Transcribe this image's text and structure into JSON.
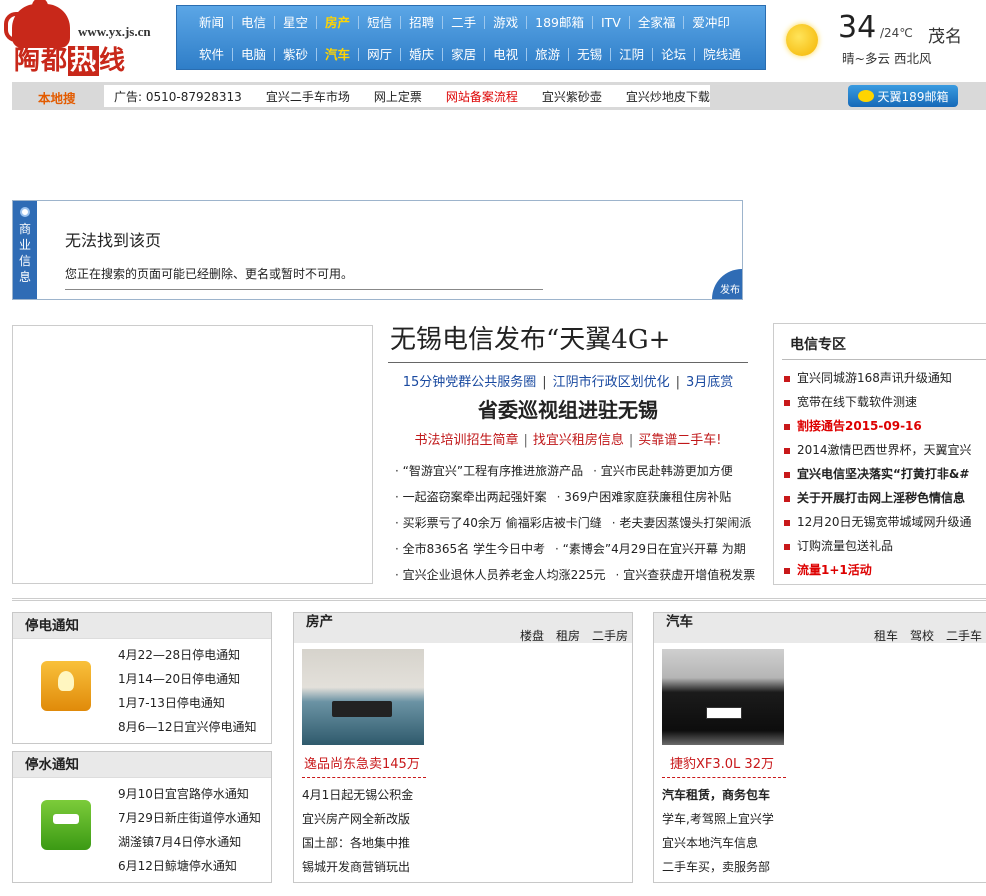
{
  "logo": {
    "url": "www.yx.js.cn",
    "name_1": "陶都",
    "name_2": "热",
    "name_3": "线"
  },
  "topnav": {
    "row1": [
      {
        "label": "新闻"
      },
      {
        "label": "电信"
      },
      {
        "label": "星空"
      },
      {
        "label": "房产",
        "highlight": true
      },
      {
        "label": "短信"
      },
      {
        "label": "招聘"
      },
      {
        "label": "二手"
      },
      {
        "label": "游戏"
      },
      {
        "label": "189邮箱"
      },
      {
        "label": "ITV"
      },
      {
        "label": "全家福"
      },
      {
        "label": "爱冲印"
      }
    ],
    "row2": [
      {
        "label": "软件"
      },
      {
        "label": "电脑"
      },
      {
        "label": "紫砂"
      },
      {
        "label": "汽车",
        "highlight": true
      },
      {
        "label": "网厅"
      },
      {
        "label": "婚庆"
      },
      {
        "label": "家居"
      },
      {
        "label": "电视"
      },
      {
        "label": "旅游"
      },
      {
        "label": "无锡"
      },
      {
        "label": "江阴"
      },
      {
        "label": "论坛"
      },
      {
        "label": "院线通"
      }
    ]
  },
  "weather": {
    "temp_high": "34",
    "temp_low": "/24℃",
    "city": "茂名",
    "desc": "晴~多云  西北风",
    "icon": "sun-icon"
  },
  "bar2": {
    "local_label": "本地搜",
    "ads": [
      {
        "text": "广告: 0510-87928313"
      },
      {
        "text": "宜兴二手车市场"
      },
      {
        "text": "网上定票"
      },
      {
        "text": "网站备案流程",
        "red": true
      },
      {
        "text": "宜兴紫砂壶"
      },
      {
        "text": "宜兴炒地皮下载"
      }
    ],
    "tianyi_label": "天翼189邮箱"
  },
  "error": {
    "tab_label": "商业信息",
    "title": "无法找到该页",
    "message": "您正在搜索的页面可能已经删除、更名或暂时不可用。",
    "publish_label": "发布"
  },
  "headline": {
    "title": "无锡电信发布“天翼4G+",
    "links1": [
      "15分钟党群公共服务圈",
      "江阴市行政区划优化",
      "3月底赏"
    ],
    "title2": "省委巡视组进驻无锡",
    "links2": [
      "书法培训招生简章",
      "找宜兴租房信息",
      "买靠谱二手车!"
    ],
    "news": [
      [
        "“智游宜兴”工程有序推进旅游产品",
        "宜兴市民赴韩游更加方便"
      ],
      [
        "一起盗窃案牵出两起强奸案",
        "369户困难家庭获廉租住房补贴"
      ],
      [
        "买彩票亏了40余万 偷福彩店被卡门缝",
        "老夫妻因蒸馒头打架闹派"
      ],
      [
        "全市8365名 学生今日中考",
        "“素博会”4月29日在宜兴开幕 为期"
      ],
      [
        "宜兴企业退休人员养老金人均涨225元",
        "宜兴查获虚开增值税发票"
      ]
    ]
  },
  "dianxin": {
    "title": "电信专区",
    "items": [
      {
        "text": "宜兴同城游168声讯升级通知",
        "style": ""
      },
      {
        "text": "宽带在线下载软件测速",
        "style": ""
      },
      {
        "text": "割接通告2015-09-16",
        "style": "red"
      },
      {
        "text": "2014激情巴西世界杯，天翼宜兴",
        "style": ""
      },
      {
        "text": "宜兴电信坚决落实“打黄打非&#",
        "style": "b"
      },
      {
        "text": "关于开展打击网上淫秽色情信息",
        "style": "b"
      },
      {
        "text": "12月20日无锡宽带城域网升级通",
        "style": ""
      },
      {
        "text": "订购流量包送礼品",
        "style": ""
      },
      {
        "text": "流量1+1活动",
        "style": "red"
      }
    ]
  },
  "power": {
    "title": "停电通知",
    "items": [
      "4月22—28日停电通知",
      "1月14—20日停电通知",
      "1月7-13日停电通知",
      "8月6—12日宜兴停电通知"
    ]
  },
  "water": {
    "title": "停水通知",
    "items": [
      "9月10日宜宫路停水通知",
      "7月29日新庄街道停水通知",
      "湖滏镇7月4日停水通知",
      "6月12日鲸塘停水通知"
    ]
  },
  "house": {
    "title": "房产",
    "links": [
      "楼盘",
      "租房",
      "二手房"
    ],
    "caption": "逸品尚东急卖145万",
    "items": [
      "4月1日起无锡公积金",
      "宜兴房产网全新改版",
      "国土部：各地集中推",
      "锡城开发商营销玩出"
    ]
  },
  "car": {
    "title": "汽车",
    "links": [
      "租车",
      "驾校",
      "二手车"
    ],
    "caption": "捷豹XF3.0L 32万",
    "items": [
      {
        "text": "汽车租赁，商务包车",
        "bold": true
      },
      {
        "text": "学车,考驾照上宜兴学",
        "bold": false
      },
      {
        "text": "宜兴本地汽车信息",
        "bold": false
      },
      {
        "text": "二手车买，卖服务部",
        "bold": false
      }
    ]
  }
}
